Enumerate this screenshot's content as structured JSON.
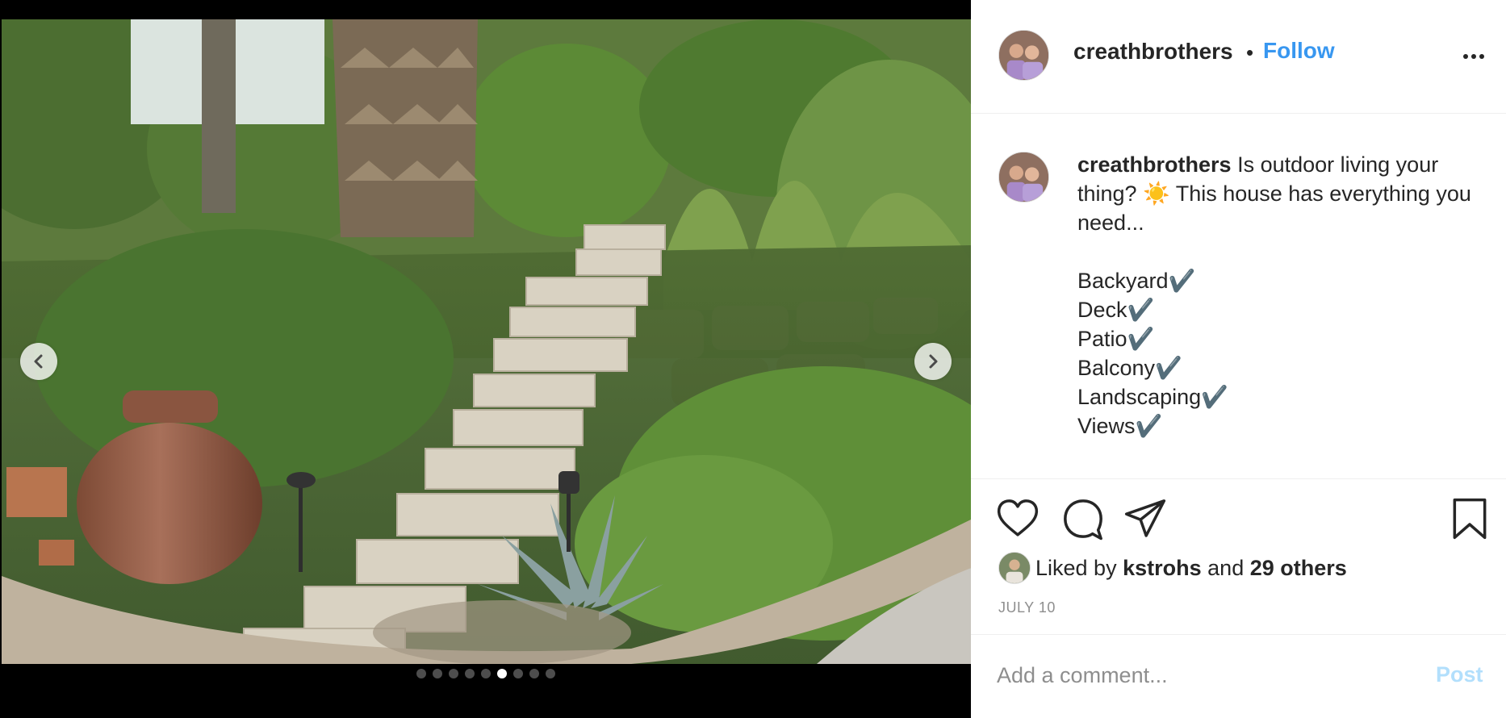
{
  "post": {
    "username": "creathbrothers",
    "follow_label": "Follow",
    "separator": "•",
    "more_icon": "more-options-icon"
  },
  "caption": {
    "username": "creathbrothers",
    "text": "Is outdoor living your thing? ☀️ This house has everything you need...",
    "items": [
      "Backyard✔️",
      "Deck✔️",
      "Patio✔️",
      "Balcony✔️",
      "Landscaping✔️",
      "Views✔️"
    ]
  },
  "carousel": {
    "dot_count": 9,
    "active_index": 5,
    "prev_icon": "chevron-left-icon",
    "next_icon": "chevron-right-icon"
  },
  "actions": {
    "like_icon": "heart-icon",
    "comment_icon": "comment-icon",
    "share_icon": "paper-plane-icon",
    "save_icon": "bookmark-icon"
  },
  "likes": {
    "prefix": "Liked by",
    "user": "kstrohs",
    "joiner": "and",
    "others": "29 others"
  },
  "date": "JULY 10",
  "comment": {
    "placeholder": "Add a comment...",
    "post_label": "Post"
  },
  "colors": {
    "follow": "#3897f0",
    "post_disabled": "#b2dffc",
    "muted": "#8e8e8e",
    "text": "#262626"
  }
}
